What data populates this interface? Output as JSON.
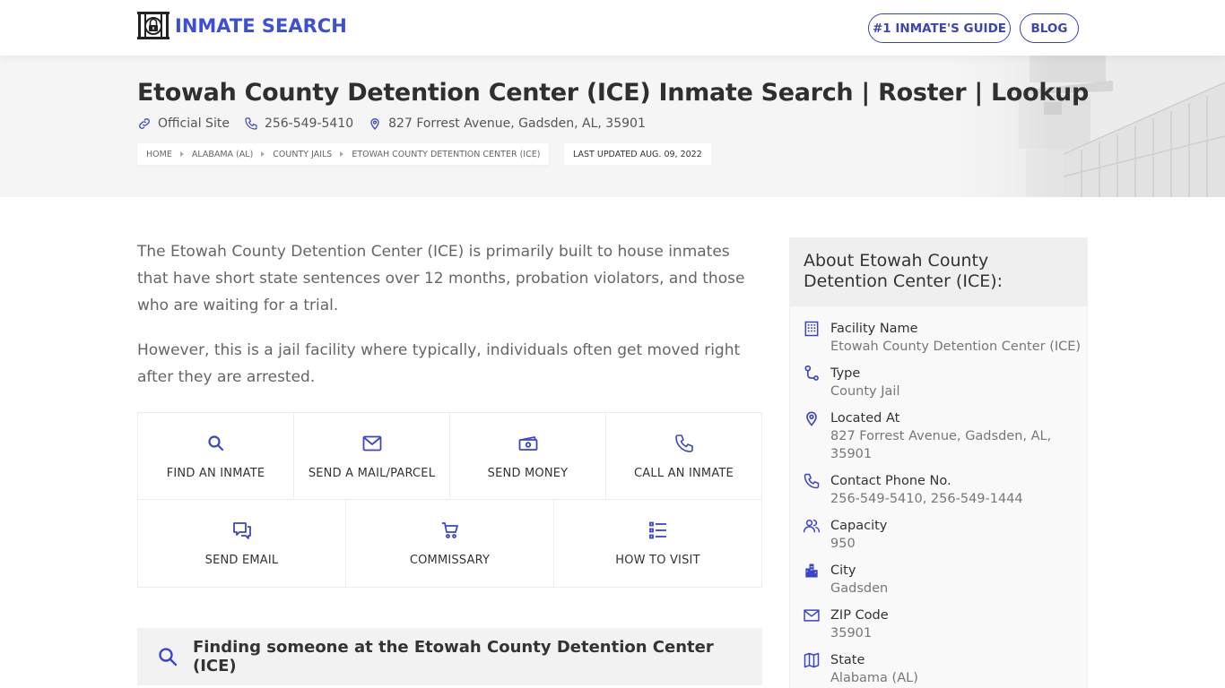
{
  "header": {
    "logo_text": "INMATE SEARCH",
    "nav": [
      {
        "label": "#1 INMATE'S GUIDE"
      },
      {
        "label": "BLOG"
      }
    ]
  },
  "hero": {
    "title": "Etowah County Detention Center (ICE) Inmate Search | Roster | Lookup",
    "official_site": "Official Site",
    "phone": "256-549-5410",
    "address": "827 Forrest Avenue, Gadsden, AL, 35901",
    "breadcrumbs": [
      "HOME",
      "ALABAMA (AL)",
      "COUNTY JAILS",
      "ETOWAH COUNTY DETENTION CENTER (ICE)"
    ],
    "last_updated": "LAST UPDATED AUG. 09, 2022"
  },
  "intro": {
    "paragraphs": [
      "The Etowah County Detention Center (ICE) is primarily built to house inmates that have short state sentences over 12 months, probation violators, and those who are waiting for a trial.",
      "However, this is a jail facility where typically, individuals often get moved right after they are arrested."
    ]
  },
  "actions": [
    {
      "label": "FIND AN INMATE",
      "icon": "search-icon"
    },
    {
      "label": "SEND A MAIL/PARCEL",
      "icon": "mail-icon"
    },
    {
      "label": "SEND MONEY",
      "icon": "money-icon"
    },
    {
      "label": "CALL AN INMATE",
      "icon": "phone-icon"
    },
    {
      "label": "SEND EMAIL",
      "icon": "chat-icon"
    },
    {
      "label": "COMMISSARY",
      "icon": "cart-icon"
    },
    {
      "label": "HOW TO VISIT",
      "icon": "list-icon"
    }
  ],
  "finding": {
    "text": "Finding someone at the Etowah County Detention Center (ICE)"
  },
  "sidebar": {
    "title": "About Etowah County Detention Center (ICE):",
    "items": [
      {
        "label": "Facility Name",
        "value": "Etowah County Detention Center (ICE)",
        "icon": "building-icon"
      },
      {
        "label": "Type",
        "value": "County Jail",
        "icon": "route-icon"
      },
      {
        "label": "Located At",
        "value": "827 Forrest Avenue, Gadsden, AL, 35901",
        "icon": "location-pin-icon"
      },
      {
        "label": "Contact Phone No.",
        "value": "256-549-5410, 256-549-1444",
        "icon": "phone-icon"
      },
      {
        "label": "Capacity",
        "value": "950",
        "icon": "users-icon"
      },
      {
        "label": "City",
        "value": "Gadsden",
        "icon": "city-icon"
      },
      {
        "label": "ZIP Code",
        "value": "35901",
        "icon": "envelope-icon"
      },
      {
        "label": "State",
        "value": "Alabama (AL)",
        "icon": "map-icon"
      }
    ]
  },
  "colors": {
    "accent": "#3b4fd8",
    "nav_border": "#3b45b5",
    "icon": "#3b45c8",
    "hero_bg": "#f5f5f5"
  }
}
